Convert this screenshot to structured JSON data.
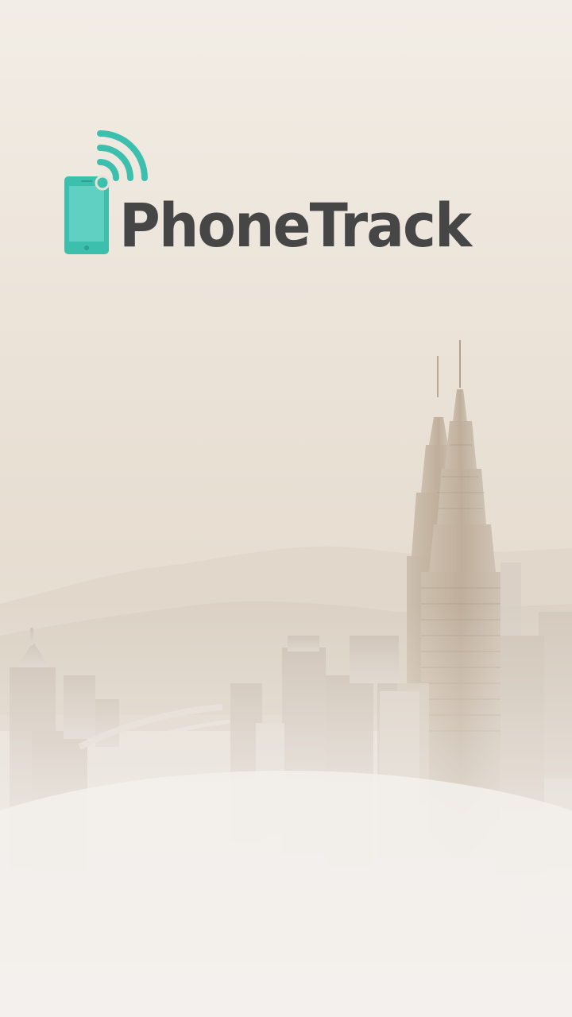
{
  "app": {
    "brand_name": "PhoneTrack"
  },
  "colors": {
    "brand_teal": "#3dbfae",
    "brand_text": "#464646",
    "sky": "#ece4d9",
    "fog": "#f2efeb"
  },
  "icons": {
    "logo_icon": "phone-signal-icon"
  },
  "background": {
    "description_icon": "city-skyline-image"
  }
}
